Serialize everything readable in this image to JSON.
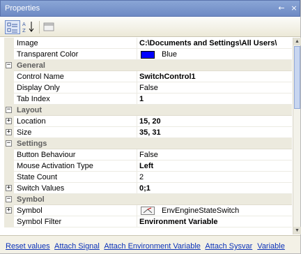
{
  "window": {
    "title": "Properties",
    "pin_glyph": "←",
    "close_glyph": "×"
  },
  "toolbar": {
    "categorized_icon": "categorized-view-icon",
    "alphabetical_icon": "alphabetical-sort-icon",
    "property_pages_icon": "property-pages-icon"
  },
  "grid": {
    "rows": [
      {
        "type": "prop",
        "name": "Image",
        "value": "C:\\Documents and Settings\\All Users\\",
        "bold": true
      },
      {
        "type": "prop",
        "name": "Transparent Color",
        "value": "Blue",
        "swatch": "#0000ff"
      },
      {
        "type": "cat",
        "name": "General",
        "expander": "−"
      },
      {
        "type": "prop",
        "name": "Control Name",
        "value": "SwitchControl1",
        "bold": true
      },
      {
        "type": "prop",
        "name": "Display Only",
        "value": "False"
      },
      {
        "type": "prop",
        "name": "Tab Index",
        "value": "1",
        "bold": true
      },
      {
        "type": "cat",
        "name": "Layout",
        "expander": "−"
      },
      {
        "type": "prop",
        "name": "Location",
        "value": "15, 20",
        "bold": true,
        "expander": "+"
      },
      {
        "type": "prop",
        "name": "Size",
        "value": "35, 31",
        "bold": true,
        "expander": "+"
      },
      {
        "type": "cat",
        "name": "Settings",
        "expander": "−"
      },
      {
        "type": "prop",
        "name": "Button Behaviour",
        "value": "False"
      },
      {
        "type": "prop",
        "name": "Mouse Activation Type",
        "value": "Left",
        "bold": true
      },
      {
        "type": "prop",
        "name": "State Count",
        "value": "2"
      },
      {
        "type": "prop",
        "name": "Switch Values",
        "value": "0;1",
        "bold": true,
        "expander": "+"
      },
      {
        "type": "cat",
        "name": "Symbol",
        "expander": "−"
      },
      {
        "type": "prop",
        "name": "Symbol",
        "value": "EnvEngineStateSwitch",
        "expander": "+",
        "symbol_icon": "switch-symbol-icon"
      },
      {
        "type": "prop",
        "name": "Symbol Filter",
        "value": "Environment Variable",
        "bold": true
      }
    ]
  },
  "scrollbar": {
    "up_glyph": "▲",
    "down_glyph": "▼"
  },
  "footer": {
    "links": [
      "Reset values",
      "Attach Signal",
      "Attach Environment Variable",
      "Attach Sysvar",
      "Variable"
    ]
  }
}
